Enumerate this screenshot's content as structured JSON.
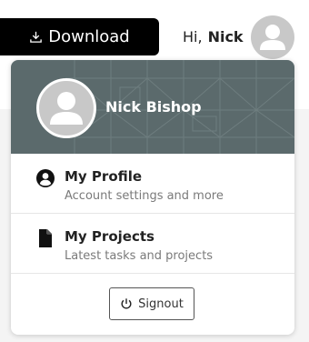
{
  "header": {
    "download_label": "Download",
    "greeting": "Hi,",
    "user_first_name": "Nick"
  },
  "dropdown": {
    "full_name": "Nick Bishop",
    "items": [
      {
        "title": "My Profile",
        "subtitle": "Account settings and more",
        "icon": "user-circle-icon"
      },
      {
        "title": "My Projects",
        "subtitle": "Latest tasks and projects",
        "icon": "document-icon"
      }
    ],
    "signout_label": "Signout"
  },
  "colors": {
    "download_bg": "#000000",
    "header_bg": "#5b6a6c",
    "avatar_bg": "#c8c8c8"
  }
}
